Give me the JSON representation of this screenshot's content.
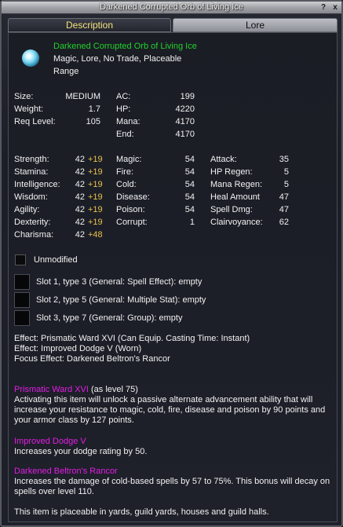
{
  "window": {
    "title": "Darkened Corrupted Orb of Living Ice",
    "help_label": "?",
    "close_label": "x"
  },
  "tabs": [
    {
      "label": "Description"
    },
    {
      "label": "Lore"
    }
  ],
  "item": {
    "name": "Darkened Corrupted Orb of Living Ice",
    "flags": "Magic, Lore, No Trade, Placeable",
    "flags2": "Range",
    "icon": "ice-orb-icon"
  },
  "basic": {
    "size_label": "Size:",
    "size_value": "MEDIUM",
    "weight_label": "Weight:",
    "weight_value": "1.7",
    "req_label": "Req Level:",
    "req_value": "105",
    "ac_label": "AC:",
    "ac_value": "199",
    "hp_label": "HP:",
    "hp_value": "4220",
    "mana_label": "Mana:",
    "mana_value": "4170",
    "end_label": "End:",
    "end_value": "4170"
  },
  "stats": [
    {
      "label": "Strength:",
      "value": "42",
      "heroic": "+19"
    },
    {
      "label": "Stamina:",
      "value": "42",
      "heroic": "+19"
    },
    {
      "label": "Intelligence:",
      "value": "42",
      "heroic": "+19"
    },
    {
      "label": "Wisdom:",
      "value": "42",
      "heroic": "+19"
    },
    {
      "label": "Agility:",
      "value": "42",
      "heroic": "+19"
    },
    {
      "label": "Dexterity:",
      "value": "42",
      "heroic": "+19"
    },
    {
      "label": "Charisma:",
      "value": "42",
      "heroic": "+48"
    }
  ],
  "resists": [
    {
      "label": "Magic:",
      "value": "54"
    },
    {
      "label": "Fire:",
      "value": "54"
    },
    {
      "label": "Cold:",
      "value": "54"
    },
    {
      "label": "Disease:",
      "value": "54"
    },
    {
      "label": "Poison:",
      "value": "54"
    },
    {
      "label": "Corrupt:",
      "value": "1"
    }
  ],
  "mods": [
    {
      "label": "Attack:",
      "value": "35"
    },
    {
      "label": "HP Regen:",
      "value": "5"
    },
    {
      "label": "Mana Regen:",
      "value": "5"
    },
    {
      "label": "Heal Amount",
      "value": "47"
    },
    {
      "label": "Spell Dmg:",
      "value": "47"
    },
    {
      "label": "Clairvoyance:",
      "value": "62"
    }
  ],
  "unmodified_label": "Unmodified",
  "slots": [
    "Slot 1, type 3 (General: Spell Effect): empty",
    "Slot 2, type 5 (General: Multiple Stat): empty",
    "Slot 3, type 7 (General: Group): empty"
  ],
  "effects": [
    "Effect: Prismatic Ward XVI (Can Equip. Casting Time: Instant)",
    "Effect: Improved Dodge V (Worn)",
    "Focus Effect: Darkened Beltron's Rancor"
  ],
  "details": {
    "ward_title": "Prismatic Ward XVI",
    "ward_level": " (as level 75)",
    "ward_desc": "Activating this item will unlock a passive alternate advancement ability that will increase your resistance to magic, cold, fire, disease and poison by 90 points and your armor class by 127 points.",
    "dodge_title": "Improved Dodge V",
    "dodge_desc": "Increases your dodge rating by 50.",
    "rancor_title": "Darkened Beltron's Rancor",
    "rancor_desc": "Increases the damage of cold-based spells by 57 to 75%. This bonus will decay on spells over level 110.",
    "placeable_note": "This item is placeable in yards, guild yards, houses and guild halls."
  }
}
